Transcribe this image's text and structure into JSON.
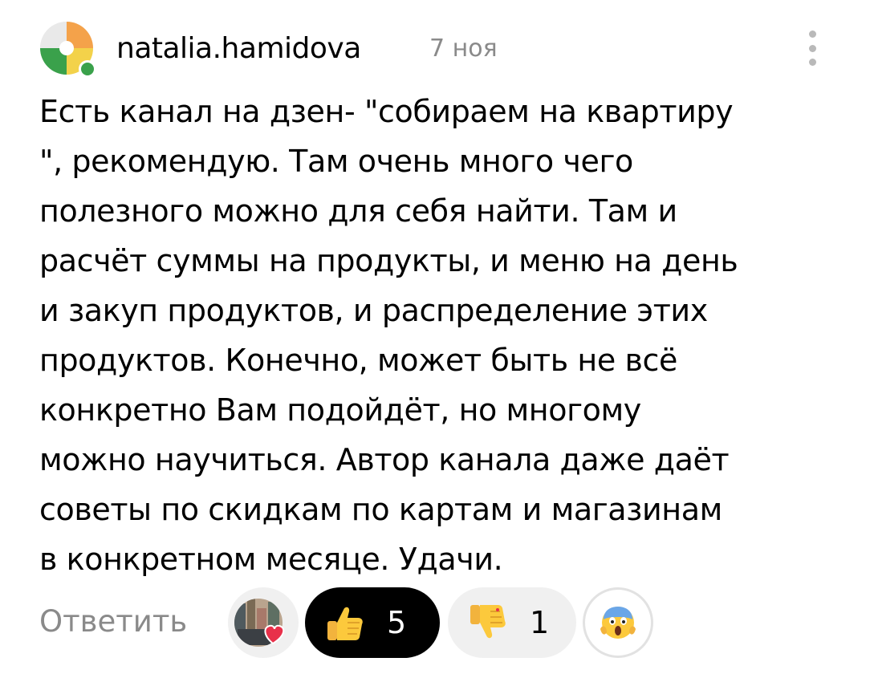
{
  "comment": {
    "author": "natalia.hamidova",
    "date": "7 ноя",
    "text_lines": [
      "Есть канал на дзен- \"собираем на квартиру",
      "\", рекомендую. Там очень много чего",
      "полезного можно для себя найти. Там и",
      "расчёт суммы на продукты, и меню на день",
      "и закуп продуктов, и распределение этих",
      "продуктов. Конечно, может быть не всё",
      "конкретно Вам подойдёт, но многому",
      "можно научиться. Автор канала даже даёт",
      "советы по скидкам по картам и магазинам",
      "в конкретном месяце. Удачи."
    ],
    "reply_label": "Ответить",
    "reactions": {
      "like": {
        "icon": "thumbs-up-icon",
        "count": "5"
      },
      "dislike": {
        "icon": "thumbs-down-icon",
        "count": "1"
      },
      "extra": {
        "icon": "screaming-face-icon"
      }
    }
  },
  "colors": {
    "muted": "#8a8a8a",
    "like_bg": "#000000",
    "dislike_bg": "#f0f0f0",
    "heart": "#e8304a"
  }
}
